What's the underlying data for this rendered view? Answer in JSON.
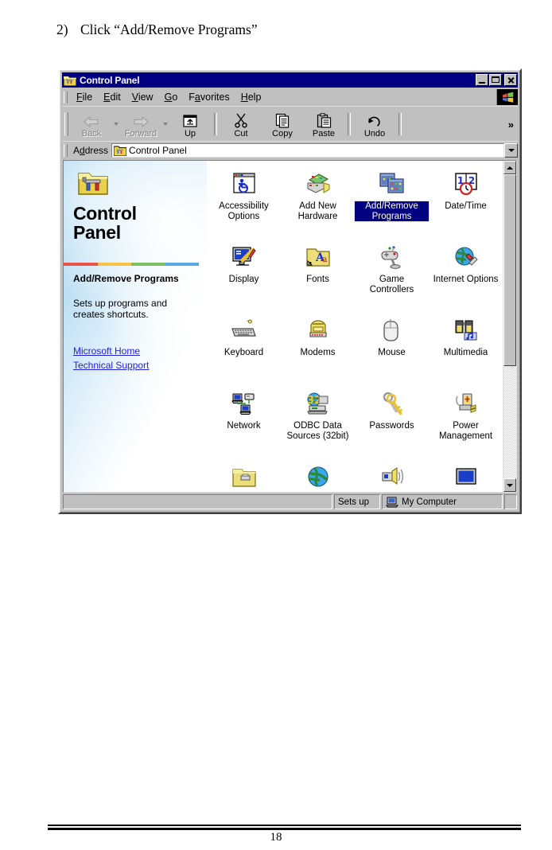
{
  "document": {
    "step_number": "2)",
    "step_text": "Click “Add/Remove Programs”",
    "page_number": "18"
  },
  "window": {
    "title": "Control Panel",
    "title_icon": "control-panel-folder-icon",
    "controls": {
      "minimize": "Minimize",
      "maximize": "Maximize",
      "close": "Close"
    }
  },
  "menu": {
    "items": [
      {
        "label": "File",
        "accel": "F"
      },
      {
        "label": "Edit",
        "accel": "E"
      },
      {
        "label": "View",
        "accel": "V"
      },
      {
        "label": "Go",
        "accel": "G"
      },
      {
        "label": "Favorites",
        "accel": "a"
      },
      {
        "label": "Help",
        "accel": "H"
      }
    ],
    "brand_icon": "windows-flag-icon"
  },
  "toolbar": {
    "buttons": [
      {
        "label": "Back",
        "icon": "back-arrow-icon",
        "disabled": true,
        "has_dropdown": true
      },
      {
        "label": "Forward",
        "icon": "forward-arrow-icon",
        "disabled": true,
        "has_dropdown": true
      },
      {
        "label": "Up",
        "icon": "up-folder-icon",
        "disabled": false,
        "has_dropdown": false
      },
      {
        "label": "Cut",
        "icon": "scissors-icon",
        "disabled": false,
        "has_dropdown": false
      },
      {
        "label": "Copy",
        "icon": "copy-pages-icon",
        "disabled": false,
        "has_dropdown": false
      },
      {
        "label": "Paste",
        "icon": "clipboard-icon",
        "disabled": false,
        "has_dropdown": false
      },
      {
        "label": "Undo",
        "icon": "undo-arrow-icon",
        "disabled": false,
        "has_dropdown": false
      }
    ],
    "overflow_label": "»"
  },
  "address": {
    "label": "Address",
    "accel": "d",
    "value": "Control Panel",
    "icon": "control-panel-folder-icon",
    "dropdown_icon": "chevron-down-icon"
  },
  "webpanel": {
    "folder_icon": "control-panel-folder-icon",
    "heading_line1": "Control",
    "heading_line2": "Panel",
    "divider_colors": [
      "#e8534a",
      "#f6c344",
      "#7dc061",
      "#5fa8e8"
    ],
    "selected_title": "Add/Remove Programs",
    "selected_description": "Sets up programs and creates shortcuts.",
    "links": [
      {
        "label": "Microsoft Home"
      },
      {
        "label": "Technical Support"
      }
    ],
    "link_color": "#2222dd"
  },
  "icons": [
    {
      "label": "Accessibility Options",
      "icon": "accessibility-icon",
      "selected": false
    },
    {
      "label": "Add New Hardware",
      "icon": "add-new-hardware-icon",
      "selected": false
    },
    {
      "label": "Add/Remove Programs",
      "icon": "add-remove-programs-icon",
      "selected": true
    },
    {
      "label": "Date/Time",
      "icon": "date-time-icon",
      "selected": false
    },
    {
      "label": "Display",
      "icon": "display-icon",
      "selected": false
    },
    {
      "label": "Fonts",
      "icon": "fonts-icon",
      "selected": false
    },
    {
      "label": "Game Controllers",
      "icon": "game-controllers-icon",
      "selected": false
    },
    {
      "label": "Internet Options",
      "icon": "internet-options-icon",
      "selected": false
    },
    {
      "label": "Keyboard",
      "icon": "keyboard-icon",
      "selected": false
    },
    {
      "label": "Modems",
      "icon": "modems-icon",
      "selected": false
    },
    {
      "label": "Mouse",
      "icon": "mouse-icon",
      "selected": false
    },
    {
      "label": "Multimedia",
      "icon": "multimedia-icon",
      "selected": false
    },
    {
      "label": "Network",
      "icon": "network-icon",
      "selected": false
    },
    {
      "label": "ODBC Data Sources (32bit)",
      "icon": "odbc-data-sources-icon",
      "selected": false
    },
    {
      "label": "Passwords",
      "icon": "passwords-key-icon",
      "selected": false
    },
    {
      "label": "Power Management",
      "icon": "power-management-icon",
      "selected": false
    },
    {
      "label": "",
      "icon": "printers-folder-icon",
      "selected": false
    },
    {
      "label": "",
      "icon": "regional-settings-globe-icon",
      "selected": false
    },
    {
      "label": "",
      "icon": "sounds-speaker-icon",
      "selected": false
    },
    {
      "label": "",
      "icon": "system-monitor-icon",
      "selected": false
    }
  ],
  "statusbar": {
    "main": "",
    "hint": "Sets up",
    "location": "My Computer",
    "location_icon": "my-computer-icon"
  },
  "scrollbar": {
    "up_icon": "scroll-up-arrow-icon",
    "down_icon": "scroll-down-arrow-icon",
    "thumb": "scroll-thumb"
  },
  "colors": {
    "titlebar": "#000080",
    "face": "#c0c0c0",
    "selection": "#000080",
    "focus_outline": "#f0e060"
  }
}
